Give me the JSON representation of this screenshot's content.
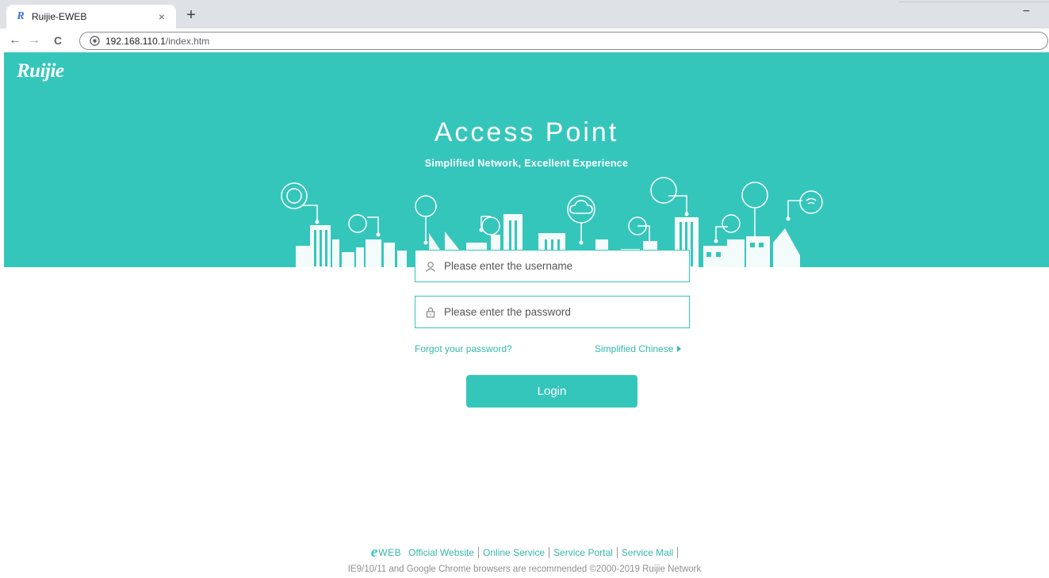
{
  "browser": {
    "tab_title": "Ruijie-EWEB",
    "tab_favicon": "R",
    "tab_close": "×",
    "new_tab": "+",
    "back_glyph": "←",
    "forward_glyph": "→",
    "reload_glyph": "C",
    "minimize_glyph": "−",
    "url_host": "192.168.110.1",
    "url_path": "/index.htm"
  },
  "banner": {
    "logo": "Ruijie",
    "title": "Access Point",
    "subtitle": "Simplified Network, Excellent Experience"
  },
  "login": {
    "username_placeholder": "Please enter the username",
    "password_placeholder": "Please enter the password",
    "forgot_label": "Forgot your password?",
    "language_label": "Simplified Chinese",
    "login_label": "Login"
  },
  "footer": {
    "brand_e": "e",
    "brand_text": "WEB",
    "links": [
      "Official Website",
      "Online Service",
      "Service Portal",
      "Service Mail"
    ],
    "note": "IE9/10/11 and Google Chrome browsers are recommended  ©2000-2019 Ruijie Network"
  },
  "colors": {
    "accent": "#35c6bb",
    "link": "#35b8ae",
    "muted": "#909090"
  }
}
